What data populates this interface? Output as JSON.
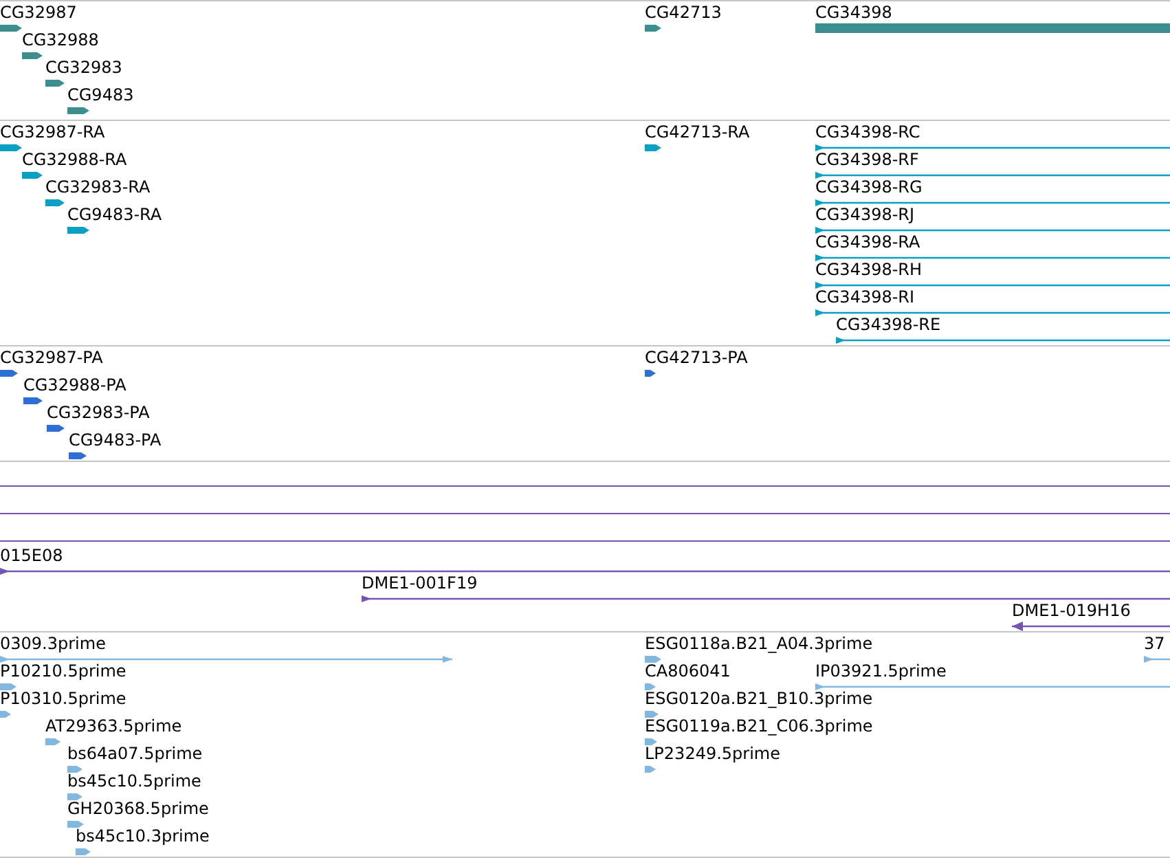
{
  "tracks": [
    {
      "kind": "gene",
      "color": "#3d8f8f",
      "features": [
        {
          "label": "CG32987",
          "reverse": false
        },
        {
          "label": "CG32988",
          "reverse": false
        },
        {
          "label": "CG32983",
          "reverse": false
        },
        {
          "label": "CG9483",
          "reverse": false
        },
        {
          "label": "CG42713",
          "reverse": false
        },
        {
          "label": "CG34398"
        }
      ]
    },
    {
      "kind": "transcript",
      "color": "#0aa0c4",
      "features": [
        {
          "label": "CG32987-RA",
          "reverse": false
        },
        {
          "label": "CG32988-RA",
          "reverse": false
        },
        {
          "label": "CG32983-RA",
          "reverse": false
        },
        {
          "label": "CG9483-RA",
          "reverse": false
        },
        {
          "label": "CG42713-RA",
          "reverse": false
        },
        {
          "label": "CG34398-RC",
          "reverse": false
        },
        {
          "label": "CG34398-RF",
          "reverse": false
        },
        {
          "label": "CG34398-RG",
          "reverse": false
        },
        {
          "label": "CG34398-RJ",
          "reverse": false
        },
        {
          "label": "CG34398-RA",
          "reverse": false
        },
        {
          "label": "CG34398-RH",
          "reverse": false
        },
        {
          "label": "CG34398-RI",
          "reverse": false
        },
        {
          "label": "CG34398-RE",
          "reverse": false
        }
      ]
    },
    {
      "kind": "protein",
      "color": "#2e6fd6",
      "features": [
        {
          "label": "CG32987-PA",
          "reverse": false
        },
        {
          "label": "CG32988-PA",
          "reverse": false
        },
        {
          "label": "CG32983-PA",
          "reverse": false
        },
        {
          "label": "CG9483-PA",
          "reverse": false
        },
        {
          "label": "CG42713-PA",
          "reverse": false
        }
      ]
    },
    {
      "kind": "clone",
      "color": "#7355b5",
      "features": [
        {
          "label": "015E08",
          "reverse": false
        },
        {
          "label": "DME1-001F19",
          "reverse": false
        },
        {
          "label": "DME1-019H16",
          "reverse": true
        }
      ]
    },
    {
      "kind": "est",
      "color": "#82b8e0",
      "features": [
        {
          "label": "0309.3prime",
          "reverse": false
        },
        {
          "label": "ESG0118a.B21_A04.3prime",
          "reverse": false
        },
        {
          "label": "37",
          "reverse": false
        },
        {
          "label": "P10210.5prime",
          "reverse": false
        },
        {
          "label": "CA806041",
          "reverse": false
        },
        {
          "label": "IP03921.5prime",
          "reverse": false
        },
        {
          "label": "P10310.5prime",
          "reverse": false
        },
        {
          "label": "ESG0120a.B21_B10.3prime",
          "reverse": false
        },
        {
          "label": "AT29363.5prime",
          "reverse": false
        },
        {
          "label": "ESG0119a.B21_C06.3prime",
          "reverse": false
        },
        {
          "label": "bs64a07.5prime",
          "reverse": false
        },
        {
          "label": "LP23249.5prime",
          "reverse": false
        },
        {
          "label": "bs45c10.5prime",
          "reverse": false
        },
        {
          "label": "GH20368.5prime",
          "reverse": false
        },
        {
          "label": "bs45c10.3prime",
          "reverse": false
        }
      ]
    }
  ]
}
